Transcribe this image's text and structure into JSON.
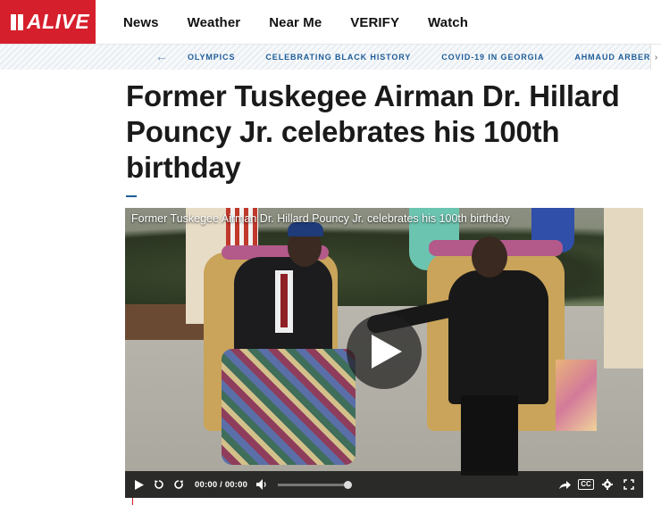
{
  "brand": {
    "logo_text": "ALIVE",
    "color": "#d61f2c"
  },
  "nav": {
    "items": [
      "News",
      "Weather",
      "Near Me",
      "VERIFY",
      "Watch"
    ]
  },
  "topics": {
    "items": [
      "OLYMPICS",
      "CELEBRATING BLACK HISTORY",
      "COVID-19 IN GEORGIA",
      "AHMAUD ARBERY'S D"
    ],
    "accent": "#1e5d98"
  },
  "article": {
    "headline": "Former Tuskegee Airman Dr. Hillard Pouncy Jr. celebrates his 100th birthday"
  },
  "video": {
    "title": "Former Tuskegee Airman Dr. Hillard Pouncy Jr. celebrates his 100th birthday",
    "time": "00:00 / 00:00"
  },
  "icons": {
    "logo": "alive-logo-icon",
    "prev": "arrow-left-icon",
    "next": "chevron-right-icon",
    "play": "play-icon",
    "replay": "replay-icon",
    "forward": "forward-icon",
    "volume": "volume-icon",
    "share": "share-icon",
    "captions": "cc-icon",
    "settings": "gear-icon",
    "fullscreen": "fullscreen-icon"
  }
}
